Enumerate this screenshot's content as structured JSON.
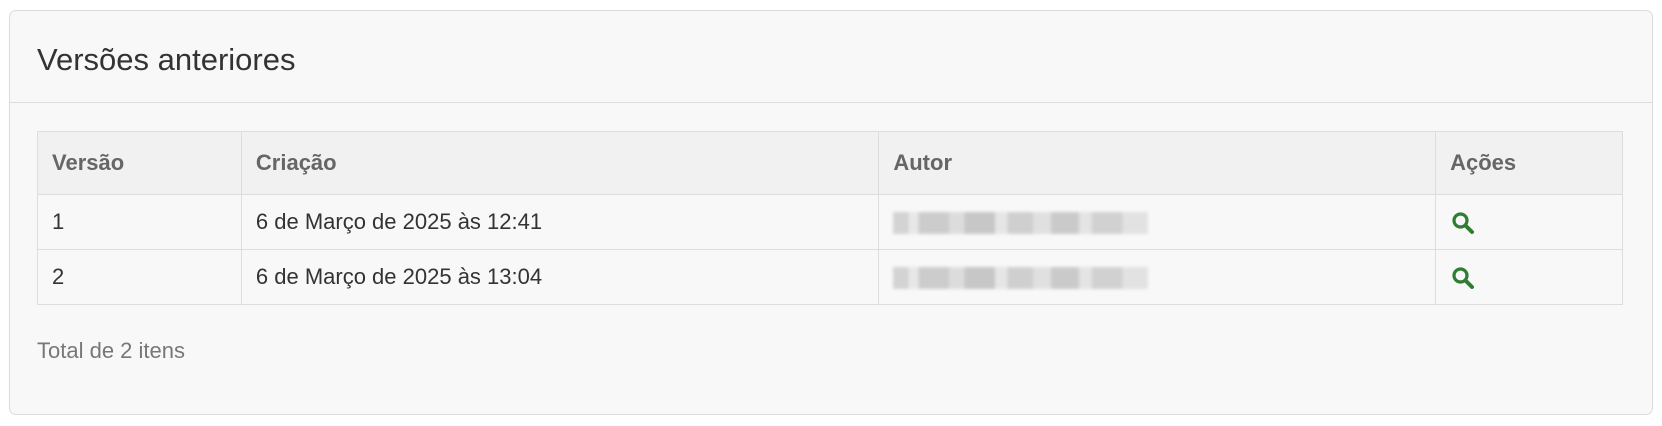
{
  "panel": {
    "title": "Versões anteriores"
  },
  "table": {
    "headers": [
      "Versão",
      "Criação",
      "Autor",
      "Ações"
    ],
    "rows": [
      {
        "version": "1",
        "created": "6 de Março de 2025 às 12:41",
        "author": "",
        "action_icon": "search-icon"
      },
      {
        "version": "2",
        "created": "6 de Março de 2025 às 13:04",
        "author": "",
        "action_icon": "search-icon"
      }
    ]
  },
  "footer": {
    "total_text": "Total de 2 itens"
  },
  "colors": {
    "action_icon": "#2e7d32",
    "header_bg": "#f1f1f1",
    "border": "#dddddd"
  }
}
